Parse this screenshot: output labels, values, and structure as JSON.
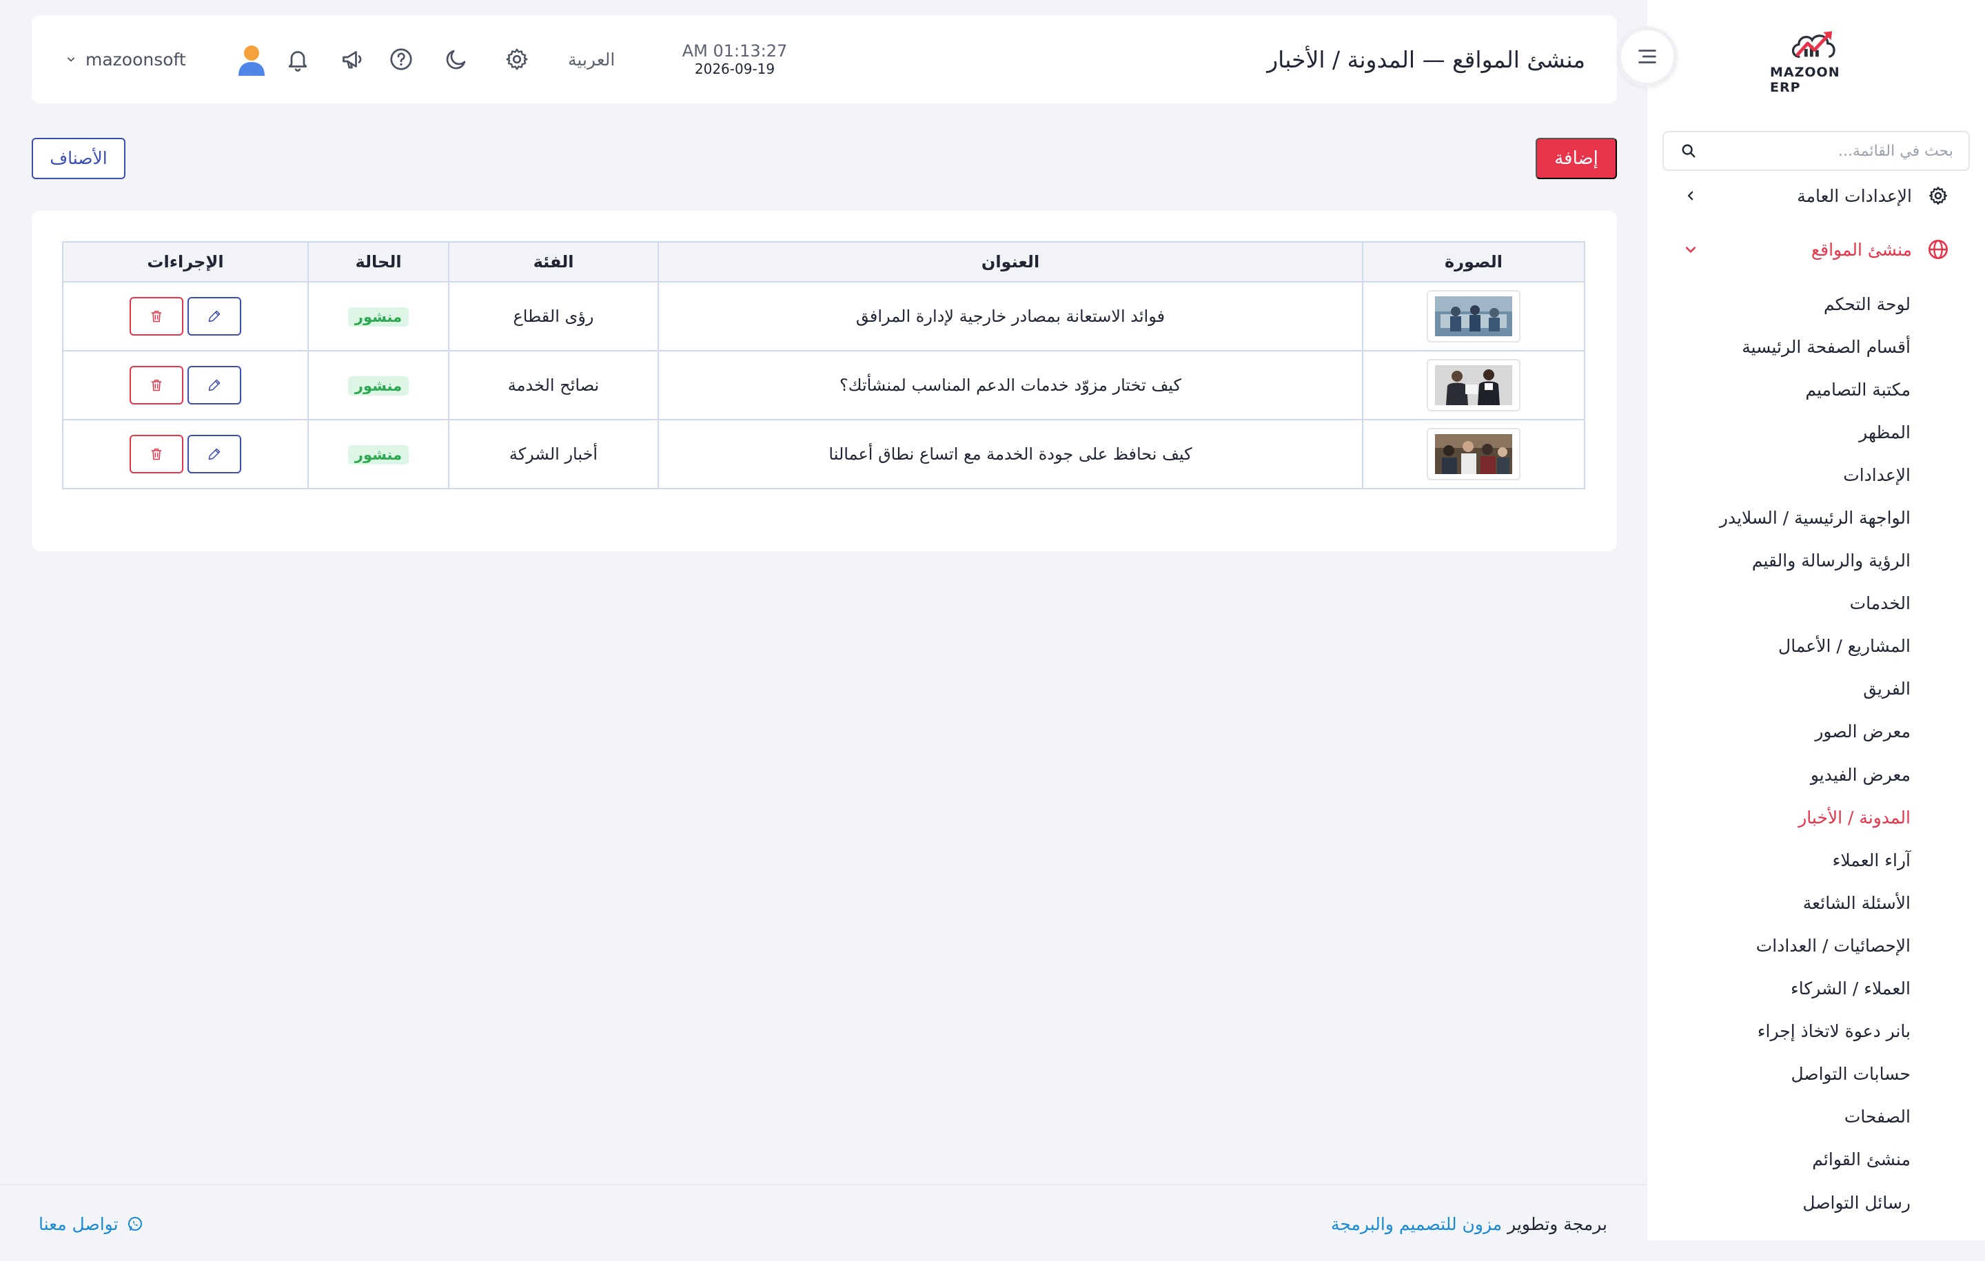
{
  "header": {
    "title": "منشئ المواقع — المدونة / الأخبار",
    "time": "AM 01:13:27",
    "date": "2026-09-19",
    "language": "العربية",
    "username": "mazoonsoft"
  },
  "brand": {
    "logo_text": "MAZOON ERP"
  },
  "search": {
    "placeholder": "بحث في القائمة..."
  },
  "sidebar": {
    "general_settings": "الإعدادات العامة",
    "site_builder": "منشئ المواقع",
    "items": [
      "لوحة التحكم",
      "أقسام الصفحة الرئيسية",
      "مكتبة التصاميم",
      "المظهر",
      "الإعدادات",
      "الواجهة الرئيسية / السلايدر",
      "الرؤية والرسالة والقيم",
      "الخدمات",
      "المشاريع / الأعمال",
      "الفريق",
      "معرض الصور",
      "معرض الفيديو",
      "المدونة / الأخبار",
      "آراء العملاء",
      "الأسئلة الشائعة",
      "الإحصائيات / العدادات",
      "العملاء / الشركاء",
      "بانر دعوة لاتخاذ إجراء",
      "حسابات التواصل",
      "الصفحات",
      "منشئ القوائم",
      "رسائل التواصل"
    ],
    "active_item": "المدونة / الأخبار"
  },
  "actions": {
    "add_label": "إضافة",
    "categories_label": "الأصناف"
  },
  "table": {
    "headers": {
      "image": "الصورة",
      "title": "العنوان",
      "category": "الفئة",
      "status": "الحالة",
      "actions": "الإجراءات"
    },
    "rows": [
      {
        "title": "فوائد الاستعانة بمصادر خارجية لإدارة المرافق",
        "category": "رؤى القطاع",
        "status": "منشور"
      },
      {
        "title": "كيف تختار مزوّد خدمات الدعم المناسب لمنشأتك؟",
        "category": "نصائح الخدمة",
        "status": "منشور"
      },
      {
        "title": "كيف نحافظ على جودة الخدمة مع اتساع نطاق أعمالنا",
        "category": "أخبار الشركة",
        "status": "منشور"
      }
    ]
  },
  "footer": {
    "credit_prefix": "برمجة وتطوير",
    "credit_link": "مزون للتصميم والبرمجة",
    "contact": "تواصل معنا"
  },
  "colors": {
    "accent": "#e8344a",
    "primary": "#3b4db5",
    "success_bg": "#dcf5e4",
    "success_text": "#2ca84e",
    "link": "#1a8ad4"
  }
}
